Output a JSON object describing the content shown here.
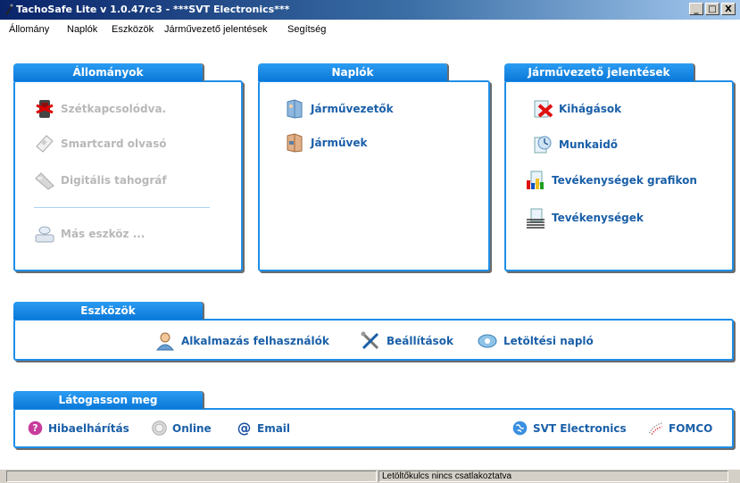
{
  "window": {
    "title": "TachoSafe Lite v 1.0.47rc3 - ***SVT Electronics***",
    "minimize": "_",
    "maximize": "□",
    "close": "X"
  },
  "menu": [
    "Állomány",
    "Naplók",
    "Eszközök",
    "Járművezető jelentések",
    "Segítség"
  ],
  "panels": {
    "allomanyok": {
      "title": "Állományok",
      "items": [
        "Szétkapcsolódva.",
        "Smartcard olvasó",
        "Digitális tahográf",
        "Más eszköz ..."
      ]
    },
    "naplok": {
      "title": "Naplók",
      "items": [
        "Járművezetők",
        "Járművek"
      ]
    },
    "jelentesek": {
      "title": "Járművezető jelentések",
      "items": [
        "Kihágások",
        "Munkaidő",
        "Tevékenységek grafikon",
        "Tevékenységek"
      ]
    },
    "eszkozok": {
      "title": "Eszközök",
      "items": [
        "Alkalmazás felhasználók",
        "Beállítások",
        "Letöltési napló"
      ]
    },
    "latogasson": {
      "title": "Látogasson meg",
      "items": [
        "Hibaelhárítás",
        "Online",
        "Email",
        "SVT Electronics",
        "FOMCO"
      ]
    }
  },
  "status": {
    "left": "",
    "right": "Letöltőkulcs nincs csatlakoztatva"
  },
  "colors": {
    "accent": "#1e8ee8",
    "link": "#1a5fa8",
    "disabled": "#b8b8b8"
  }
}
